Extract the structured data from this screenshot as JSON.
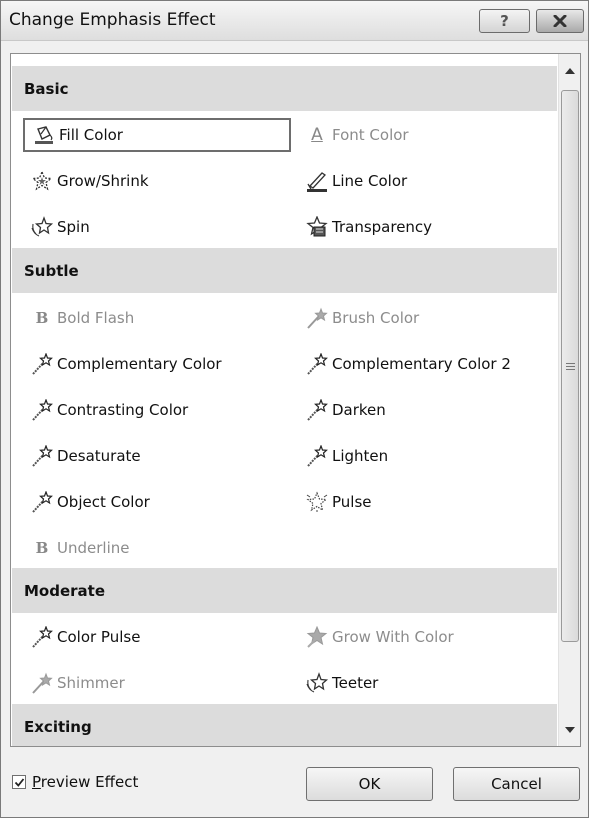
{
  "dialog": {
    "title": "Change Emphasis Effect",
    "help_glyph": "?"
  },
  "categories": [
    {
      "label": "Basic",
      "items": [
        {
          "label": "Fill Color",
          "icon": "paint-bucket-icon",
          "disabled": false,
          "selected": true
        },
        {
          "label": "Font Color",
          "icon": "font-color-icon",
          "disabled": true
        },
        {
          "label": "Grow/Shrink",
          "icon": "grow-shrink-icon",
          "disabled": false
        },
        {
          "label": "Line Color",
          "icon": "line-color-icon",
          "disabled": false
        },
        {
          "label": "Spin",
          "icon": "spin-icon",
          "disabled": false
        },
        {
          "label": "Transparency",
          "icon": "transparency-icon",
          "disabled": false
        }
      ]
    },
    {
      "label": "Subtle",
      "items": [
        {
          "label": "Bold Flash",
          "icon": "bold-icon",
          "disabled": true
        },
        {
          "label": "Brush Color",
          "icon": "star-wand-icon",
          "disabled": true
        },
        {
          "label": "Complementary Color",
          "icon": "star-wand-icon",
          "disabled": false
        },
        {
          "label": "Complementary Color 2",
          "icon": "star-wand-icon",
          "disabled": false
        },
        {
          "label": "Contrasting Color",
          "icon": "star-wand-icon",
          "disabled": false
        },
        {
          "label": "Darken",
          "icon": "star-wand-icon",
          "disabled": false
        },
        {
          "label": "Desaturate",
          "icon": "star-wand-icon",
          "disabled": false
        },
        {
          "label": "Lighten",
          "icon": "star-wand-icon",
          "disabled": false
        },
        {
          "label": "Object Color",
          "icon": "star-wand-icon",
          "disabled": false
        },
        {
          "label": "Pulse",
          "icon": "pulse-icon",
          "disabled": false
        },
        {
          "label": "Underline",
          "icon": "bold-icon",
          "disabled": true
        }
      ]
    },
    {
      "label": "Moderate",
      "items": [
        {
          "label": "Color Pulse",
          "icon": "star-wand-icon",
          "disabled": false
        },
        {
          "label": "Grow With Color",
          "icon": "star-burst-icon",
          "disabled": true
        },
        {
          "label": "Shimmer",
          "icon": "star-wand-icon",
          "disabled": true
        },
        {
          "label": "Teeter",
          "icon": "teeter-icon",
          "disabled": false
        }
      ]
    },
    {
      "label": "Exciting",
      "items": []
    }
  ],
  "preview": {
    "checked": true,
    "label_accel": "P",
    "label_rest": "review Effect"
  },
  "buttons": {
    "ok": "OK",
    "cancel": "Cancel"
  },
  "colors": {
    "category_bg": "#dcdcdc",
    "disabled_text": "#8c8c8c",
    "selected_border": "#6d6d6d"
  }
}
